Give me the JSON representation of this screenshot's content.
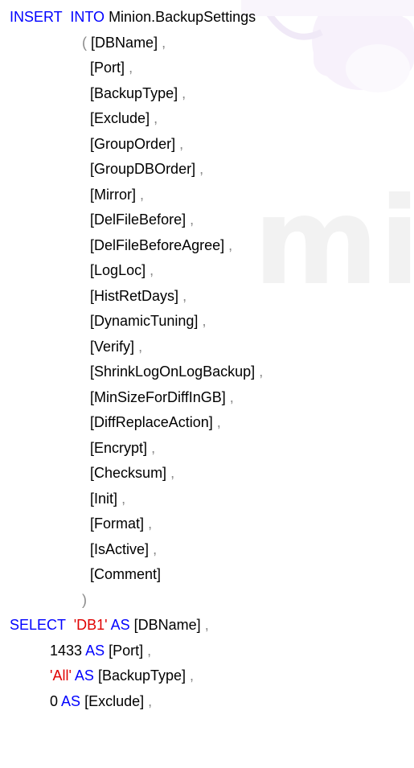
{
  "watermark": {
    "text": "minion"
  },
  "code": {
    "insert_line": {
      "kw_insert": "INSERT",
      "kw_into": "INTO",
      "table": "Minion.BackupSettings"
    },
    "column_list": [
      {
        "name": "[DBName]",
        "sep": ","
      },
      {
        "name": "[Port]",
        "sep": ","
      },
      {
        "name": "[BackupType]",
        "sep": ","
      },
      {
        "name": "[Exclude]",
        "sep": ","
      },
      {
        "name": "[GroupOrder]",
        "sep": ","
      },
      {
        "name": "[GroupDBOrder]",
        "sep": ","
      },
      {
        "name": "[Mirror]",
        "sep": ","
      },
      {
        "name": "[DelFileBefore]",
        "sep": ","
      },
      {
        "name": "[DelFileBeforeAgree]",
        "sep": ","
      },
      {
        "name": "[LogLoc]",
        "sep": ","
      },
      {
        "name": "[HistRetDays]",
        "sep": ","
      },
      {
        "name": "[DynamicTuning]",
        "sep": ","
      },
      {
        "name": "[Verify]",
        "sep": ","
      },
      {
        "name": "[ShrinkLogOnLogBackup]",
        "sep": ","
      },
      {
        "name": "[MinSizeForDiffInGB]",
        "sep": ","
      },
      {
        "name": "[DiffReplaceAction]",
        "sep": ","
      },
      {
        "name": "[Encrypt]",
        "sep": ","
      },
      {
        "name": "[Checksum]",
        "sep": ","
      },
      {
        "name": "[Init]",
        "sep": ","
      },
      {
        "name": "[Format]",
        "sep": ","
      },
      {
        "name": "[IsActive]",
        "sep": ","
      },
      {
        "name": "[Comment]",
        "sep": ""
      }
    ],
    "open_paren": "(",
    "close_paren": ")",
    "select_kw": "SELECT",
    "as_kw": "AS",
    "select_values": [
      {
        "value": "'DB1'",
        "kind": "str",
        "alias": "[DBName]",
        "sep": ","
      },
      {
        "value": "1433",
        "kind": "num",
        "alias": "[Port]",
        "sep": ","
      },
      {
        "value": "'All'",
        "kind": "str",
        "alias": "[BackupType]",
        "sep": ","
      },
      {
        "value": "0",
        "kind": "num",
        "alias": "[Exclude]",
        "sep": ","
      }
    ]
  },
  "colors": {
    "keyword": "#0000ff",
    "string": "#e00000",
    "punctuation": "#8a8a8a",
    "identifier": "#000000"
  }
}
